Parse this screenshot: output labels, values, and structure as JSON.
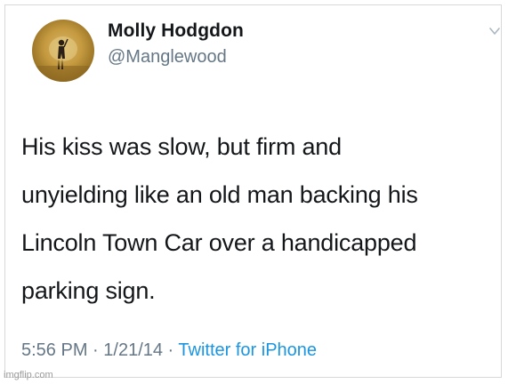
{
  "tweet": {
    "author": {
      "display_name": "Molly Hodgdon",
      "handle": "@Manglewood",
      "avatar_icon": "profile-photo"
    },
    "text_lines": [
      "His kiss was slow, but firm and",
      "unyielding like an old man backing his",
      "Lincoln Town Car over a handicapped",
      "parking sign."
    ],
    "time": "5:56 PM",
    "separator": " · ",
    "date": "1/21/14",
    "source": "Twitter for iPhone",
    "menu_icon": "chevron-down-icon"
  },
  "watermark": "imgflip.com",
  "colors": {
    "text": "#14171a",
    "muted": "#657786",
    "link": "#1b95e0"
  }
}
